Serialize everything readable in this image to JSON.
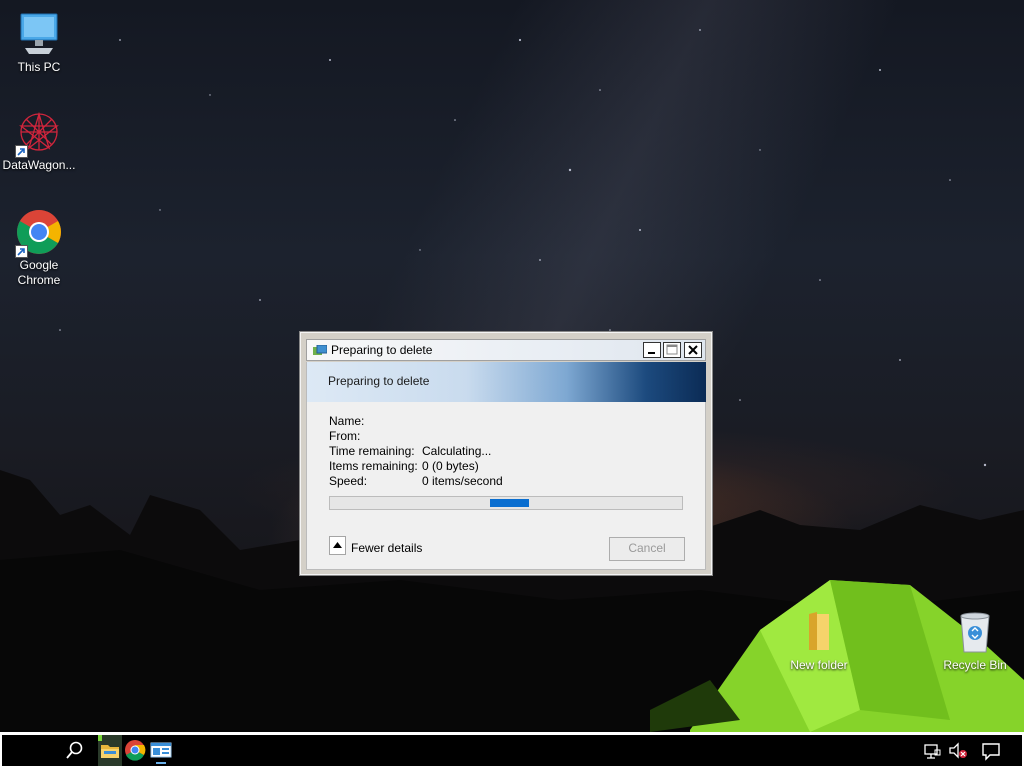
{
  "desktop": {
    "icons": [
      {
        "label": "This PC",
        "icon": "computer-icon"
      },
      {
        "label": "DataWagon...",
        "icon": "datawagon-icon"
      },
      {
        "label": "Google Chrome",
        "label_line1": "Google",
        "label_line2": "Chrome",
        "icon": "chrome-icon"
      },
      {
        "label": "New folder",
        "icon": "folder-icon"
      },
      {
        "label": "Recycle Bin",
        "icon": "recycle-bin-icon"
      }
    ]
  },
  "dialog": {
    "window_title": "Preparing to delete",
    "banner_text": "Preparing to delete",
    "details": {
      "name_label": "Name:",
      "name_value": "",
      "from_label": "From:",
      "from_value": "",
      "time_label": "Time remaining:",
      "time_value": "Calculating...",
      "items_label": "Items remaining:",
      "items_value": "0 (0 bytes)",
      "speed_label": "Speed:",
      "speed_value": "0 items/second"
    },
    "progress": {
      "mode": "indeterminate",
      "marquee_position_fraction": 0.51
    },
    "fewer_details_label": "Fewer details",
    "cancel_label": "Cancel"
  },
  "taskbar": {
    "items": [
      "start-button",
      "search-icon",
      "file-explorer-icon",
      "chrome-icon",
      "app-window-icon"
    ],
    "tray": [
      "network-icon",
      "volume-muted-icon",
      "action-center-icon"
    ]
  },
  "colors": {
    "progress_fill": "#0a6ed0",
    "banner_dark": "#0b2b55",
    "tent_green": "#8be02a"
  }
}
